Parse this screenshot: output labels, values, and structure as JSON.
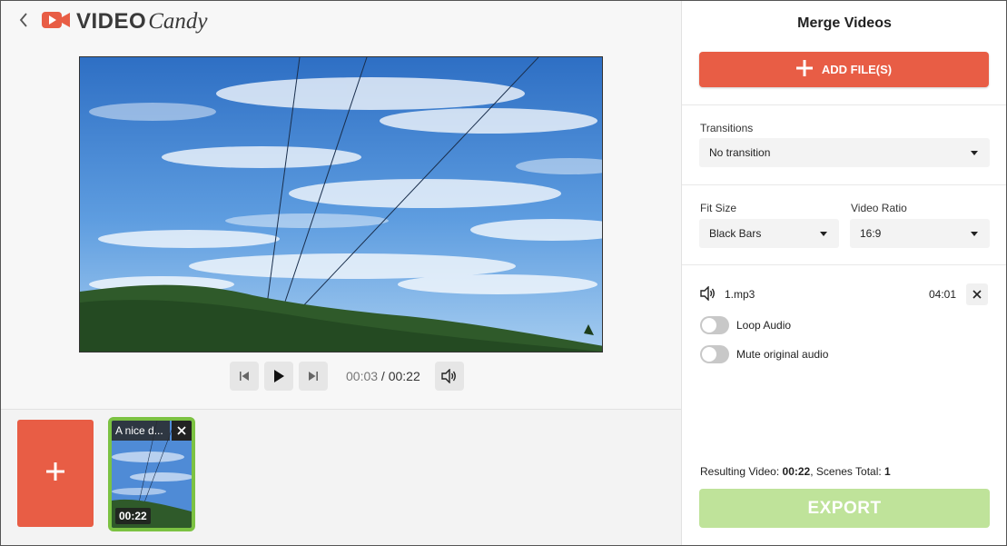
{
  "logo": {
    "word1": "VIDEO",
    "word2": "Candy",
    "brand_color": "#e85d45"
  },
  "player": {
    "current_time": "00:03",
    "separator": " / ",
    "total_time": "00:22"
  },
  "timeline": {
    "clips": [
      {
        "title": "A nice d...",
        "duration": "00:22"
      }
    ]
  },
  "panel": {
    "title": "Merge Videos",
    "add_files_label": "ADD FILE(S)",
    "transitions": {
      "label": "Transitions",
      "value": "No transition"
    },
    "fit_size": {
      "label": "Fit Size",
      "value": "Black Bars"
    },
    "video_ratio": {
      "label": "Video Ratio",
      "value": "16:9"
    },
    "audio": {
      "file_name": "1.mp3",
      "duration": "04:01"
    },
    "loop_audio": {
      "label": "Loop Audio",
      "enabled": false
    },
    "mute_original": {
      "label": "Mute original audio",
      "enabled": false
    },
    "result": {
      "prefix": "Resulting Video: ",
      "duration": "00:22",
      "middle": ", Scenes Total: ",
      "scenes": "1"
    },
    "export_label": "EXPORT"
  },
  "colors": {
    "accent": "#e85d45",
    "clip_border": "#7cc242",
    "export_disabled": "#bfe39a"
  }
}
